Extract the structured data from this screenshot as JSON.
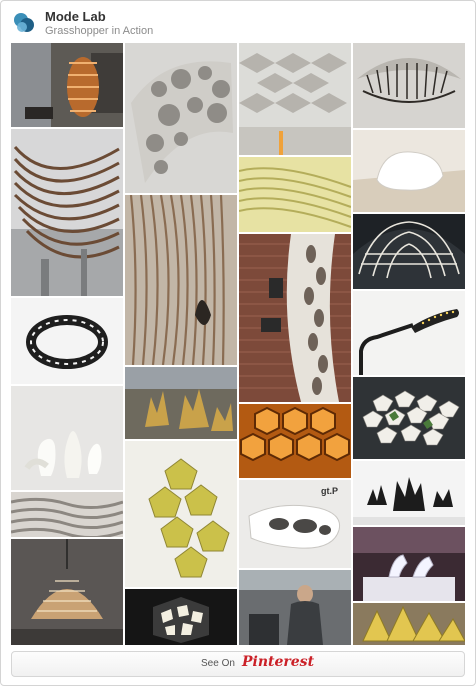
{
  "board": {
    "title": "Mode Lab",
    "subtitle": "Grasshopper in Action",
    "avatar_icon": "mode-lab-logo-icon",
    "brand_color": "#2a6f97"
  },
  "footer": {
    "see_on": "See On",
    "pinterest_logo": "Pinterest",
    "pinterest_color": "#cb2027"
  },
  "pins": [
    {
      "name": "ribbon-lamp-room",
      "icon": "image"
    },
    {
      "name": "perforated-cut-panel",
      "icon": "image"
    },
    {
      "name": "folded-ceiling-installation",
      "icon": "image"
    },
    {
      "name": "radial-fin-canopy",
      "icon": "image"
    },
    {
      "name": "waffle-grid-pavilion",
      "icon": "image"
    },
    {
      "name": "layered-contour-wall",
      "icon": "image"
    },
    {
      "name": "green-wave-panels",
      "icon": "image"
    },
    {
      "name": "white-bench-sculpture",
      "icon": "image"
    },
    {
      "name": "voronoi-ring",
      "icon": "image"
    },
    {
      "name": "perforated-column",
      "icon": "image"
    },
    {
      "name": "arched-lattice-pavilion",
      "icon": "image"
    },
    {
      "name": "led-desk-lamp",
      "icon": "image"
    },
    {
      "name": "ceramic-vases",
      "icon": "image"
    },
    {
      "name": "gold-coral-pieces",
      "icon": "image"
    },
    {
      "name": "tessellated-tiles",
      "icon": "image"
    },
    {
      "name": "layered-ceiling",
      "icon": "image"
    },
    {
      "name": "hexagon-orange-wall",
      "icon": "image"
    },
    {
      "name": "spiky-black-objects",
      "icon": "image"
    },
    {
      "name": "yellow-star-tower",
      "icon": "image"
    },
    {
      "name": "white-shelving-gtp",
      "icon": "image"
    },
    {
      "name": "pendant-lamp",
      "icon": "image"
    },
    {
      "name": "illuminated-cube",
      "icon": "image"
    },
    {
      "name": "workshop-worker",
      "icon": "image"
    },
    {
      "name": "glass-shoe-display",
      "icon": "image"
    },
    {
      "name": "gold-origami-pieces",
      "icon": "image"
    }
  ],
  "overlay_text": {
    "gtp_label": "gt.P"
  }
}
